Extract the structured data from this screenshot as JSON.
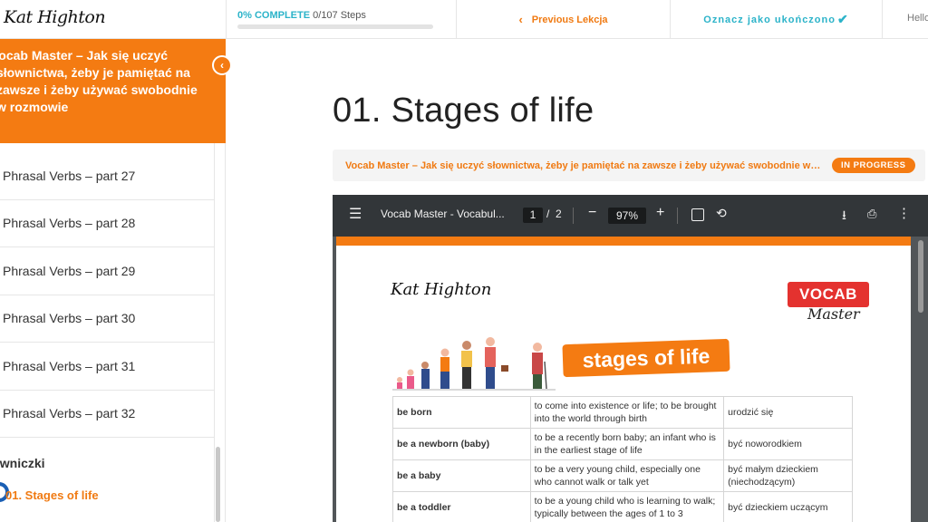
{
  "header": {
    "logo_text": "Kat Highton",
    "progress_percent_label": "0% COMPLETE",
    "progress_steps": "0/107 Steps",
    "progress_fraction": 0.0,
    "prev_label": "Previous Lekcja",
    "mark_complete_label": "Oznacz jako ukończono",
    "hello_text": "Hello"
  },
  "sidebar": {
    "course_title": "Vocab Master – Jak się uczyć słownictwa, żeby je pamiętać na zawsze i żeby używać swobodnie w rozmowie",
    "lessons": [
      "Phrasal Verbs – part 27",
      "Phrasal Verbs – part 28",
      "Phrasal Verbs – part 29",
      "Phrasal Verbs – part 30",
      "Phrasal Verbs – part 31",
      "Phrasal Verbs – part 32"
    ],
    "section_title": "Słowniczki",
    "current_lesson": "01. Stages of life"
  },
  "main": {
    "page_title": "01. Stages of life",
    "status_course": "Vocab Master – Jak się uczyć słownictwa, żeby je pamiętać na zawsze i żeby używać swobodnie w rozmowie",
    "status_badge": "IN PROGRESS"
  },
  "pdf": {
    "file_name": "Vocab Master - Vocabul...",
    "current_page": "1",
    "page_sep": "/",
    "total_pages": "2",
    "zoom": "97%",
    "doc_logo": "Kat Highton",
    "vocab_logo": "VOCAB",
    "vocab_logo_sub": "Master",
    "banner": "stages of life",
    "table": [
      [
        "be  born",
        "to come into existence or life; to be brought into the world through birth",
        "urodzić się"
      ],
      [
        "be  a newborn (baby)",
        "to be a recently born baby; an infant who is in the earliest stage of life",
        "być noworodkiem"
      ],
      [
        "be a baby",
        "to be a very young child, especially one who cannot walk or talk yet",
        "być małym dzieckiem (niechodzącym)"
      ],
      [
        "be  a toddler",
        "to be a young child who is learning to walk; typically between the ages of 1 to 3",
        "być dzieckiem uczącym"
      ]
    ]
  },
  "colors": {
    "accent_orange": "#f47b12",
    "accent_teal": "#2bb3c9",
    "vocab_red": "#e4322f",
    "pdf_toolbar": "#323639"
  },
  "icons": {
    "prev": "chevron-left-icon",
    "mark": "checkmark-icon",
    "collapse": "chevron-left-icon",
    "pdf_menu": "hamburger-menu-icon",
    "pdf_download": "download-icon",
    "pdf_print": "print-icon",
    "pdf_more": "more-vertical-icon"
  }
}
